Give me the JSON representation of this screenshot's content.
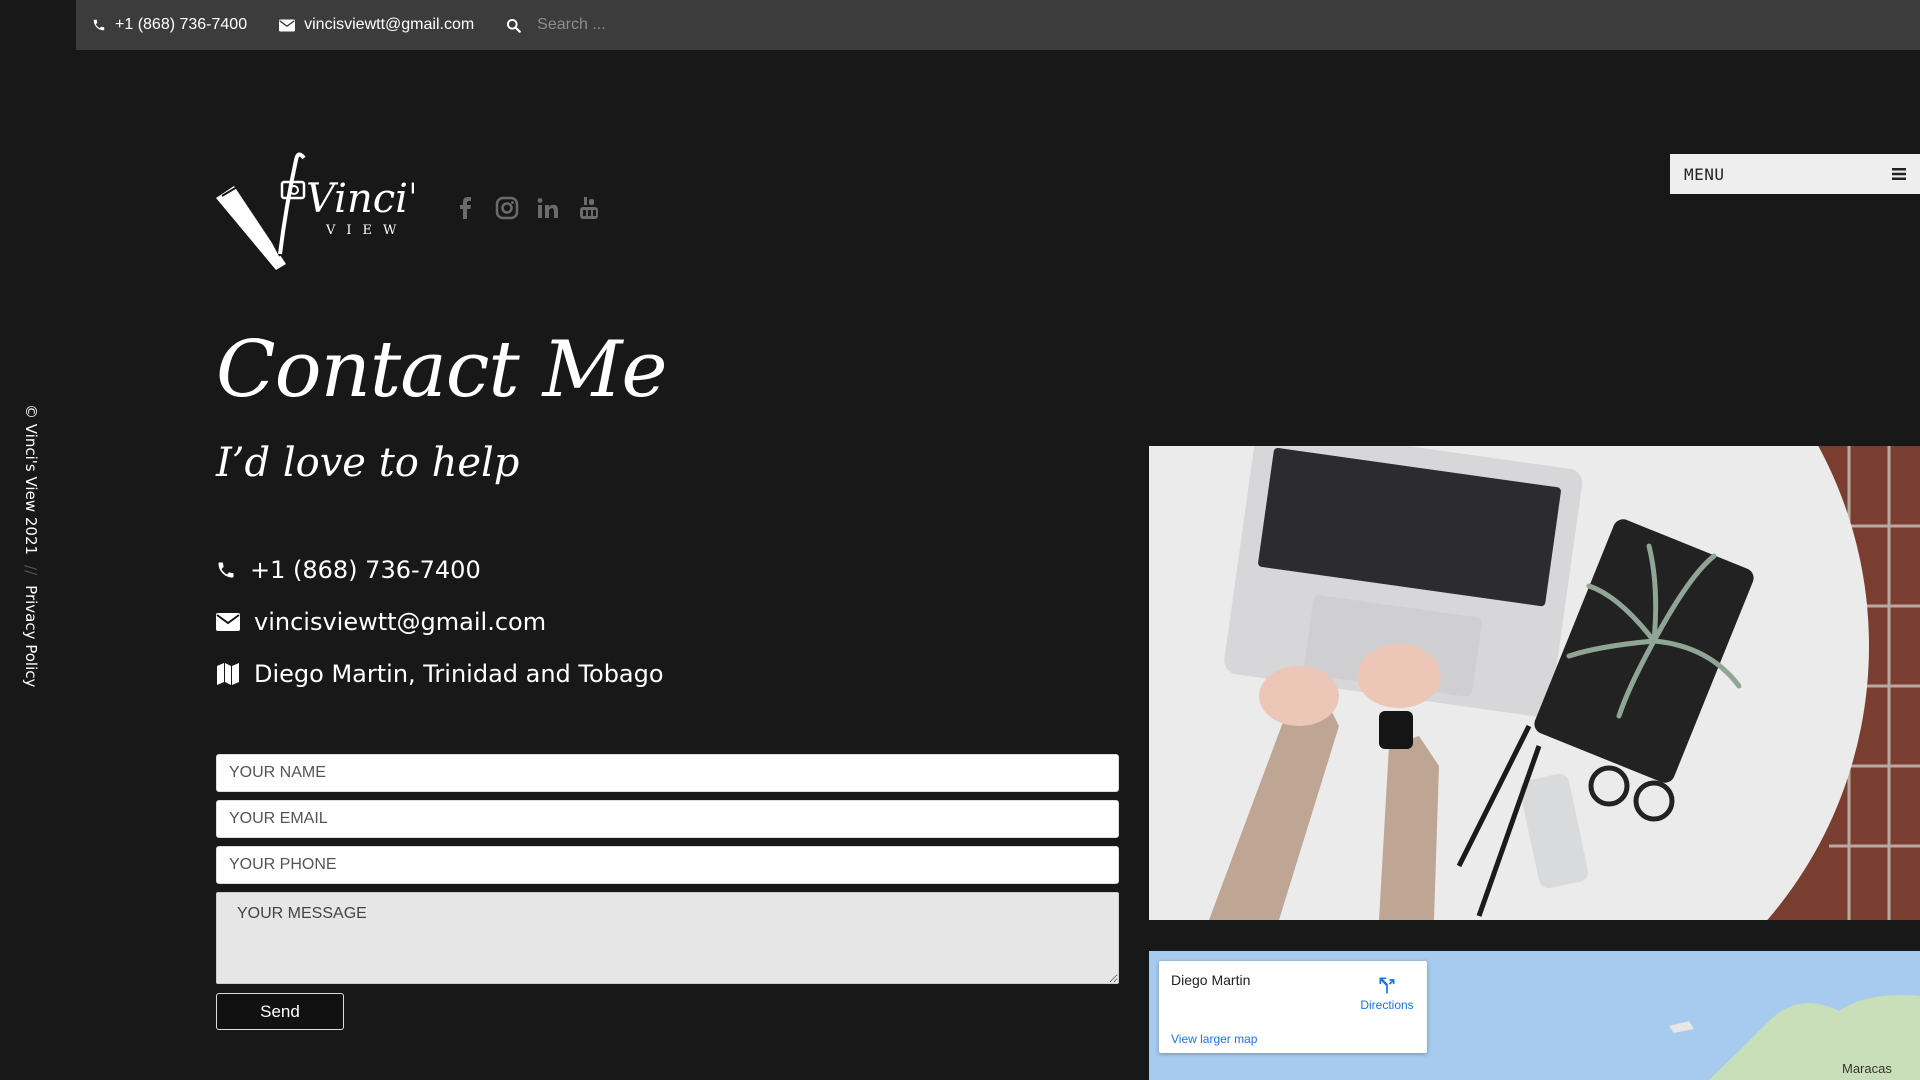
{
  "topbar": {
    "phone": "+1 (868) 736-7400",
    "email": "vincisviewtt@gmail.com",
    "search_placeholder": "Search ..."
  },
  "logo": {
    "name": "Vinci's",
    "sub": "VIEW"
  },
  "social": [
    "facebook-icon",
    "instagram-icon",
    "linkedin-icon",
    "youtube-icon"
  ],
  "menu": {
    "label": "MENU"
  },
  "sidebar": {
    "copyright": "© Vinci's View 2021",
    "separator": "//",
    "privacy": "Privacy Policy"
  },
  "page": {
    "title": "Contact Me",
    "subtitle": "I’d love to help"
  },
  "contact": {
    "phone": "+1 (868) 736-7400",
    "email": "vincisviewtt@gmail.com",
    "location": "Diego Martin, Trinidad and Tobago"
  },
  "form": {
    "name_placeholder": "YOUR NAME",
    "email_placeholder": "YOUR EMAIL",
    "phone_placeholder": "YOUR PHONE",
    "message_placeholder": "YOUR MESSAGE",
    "send_label": "Send"
  },
  "map": {
    "place": "Diego Martin",
    "directions": "Directions",
    "larger_map": "View larger map",
    "label": "Maracas"
  },
  "colors": {
    "background": "#181818",
    "topbar": "#3c3c3c",
    "link": "#1a73e8",
    "map_water": "#a6cbee"
  }
}
